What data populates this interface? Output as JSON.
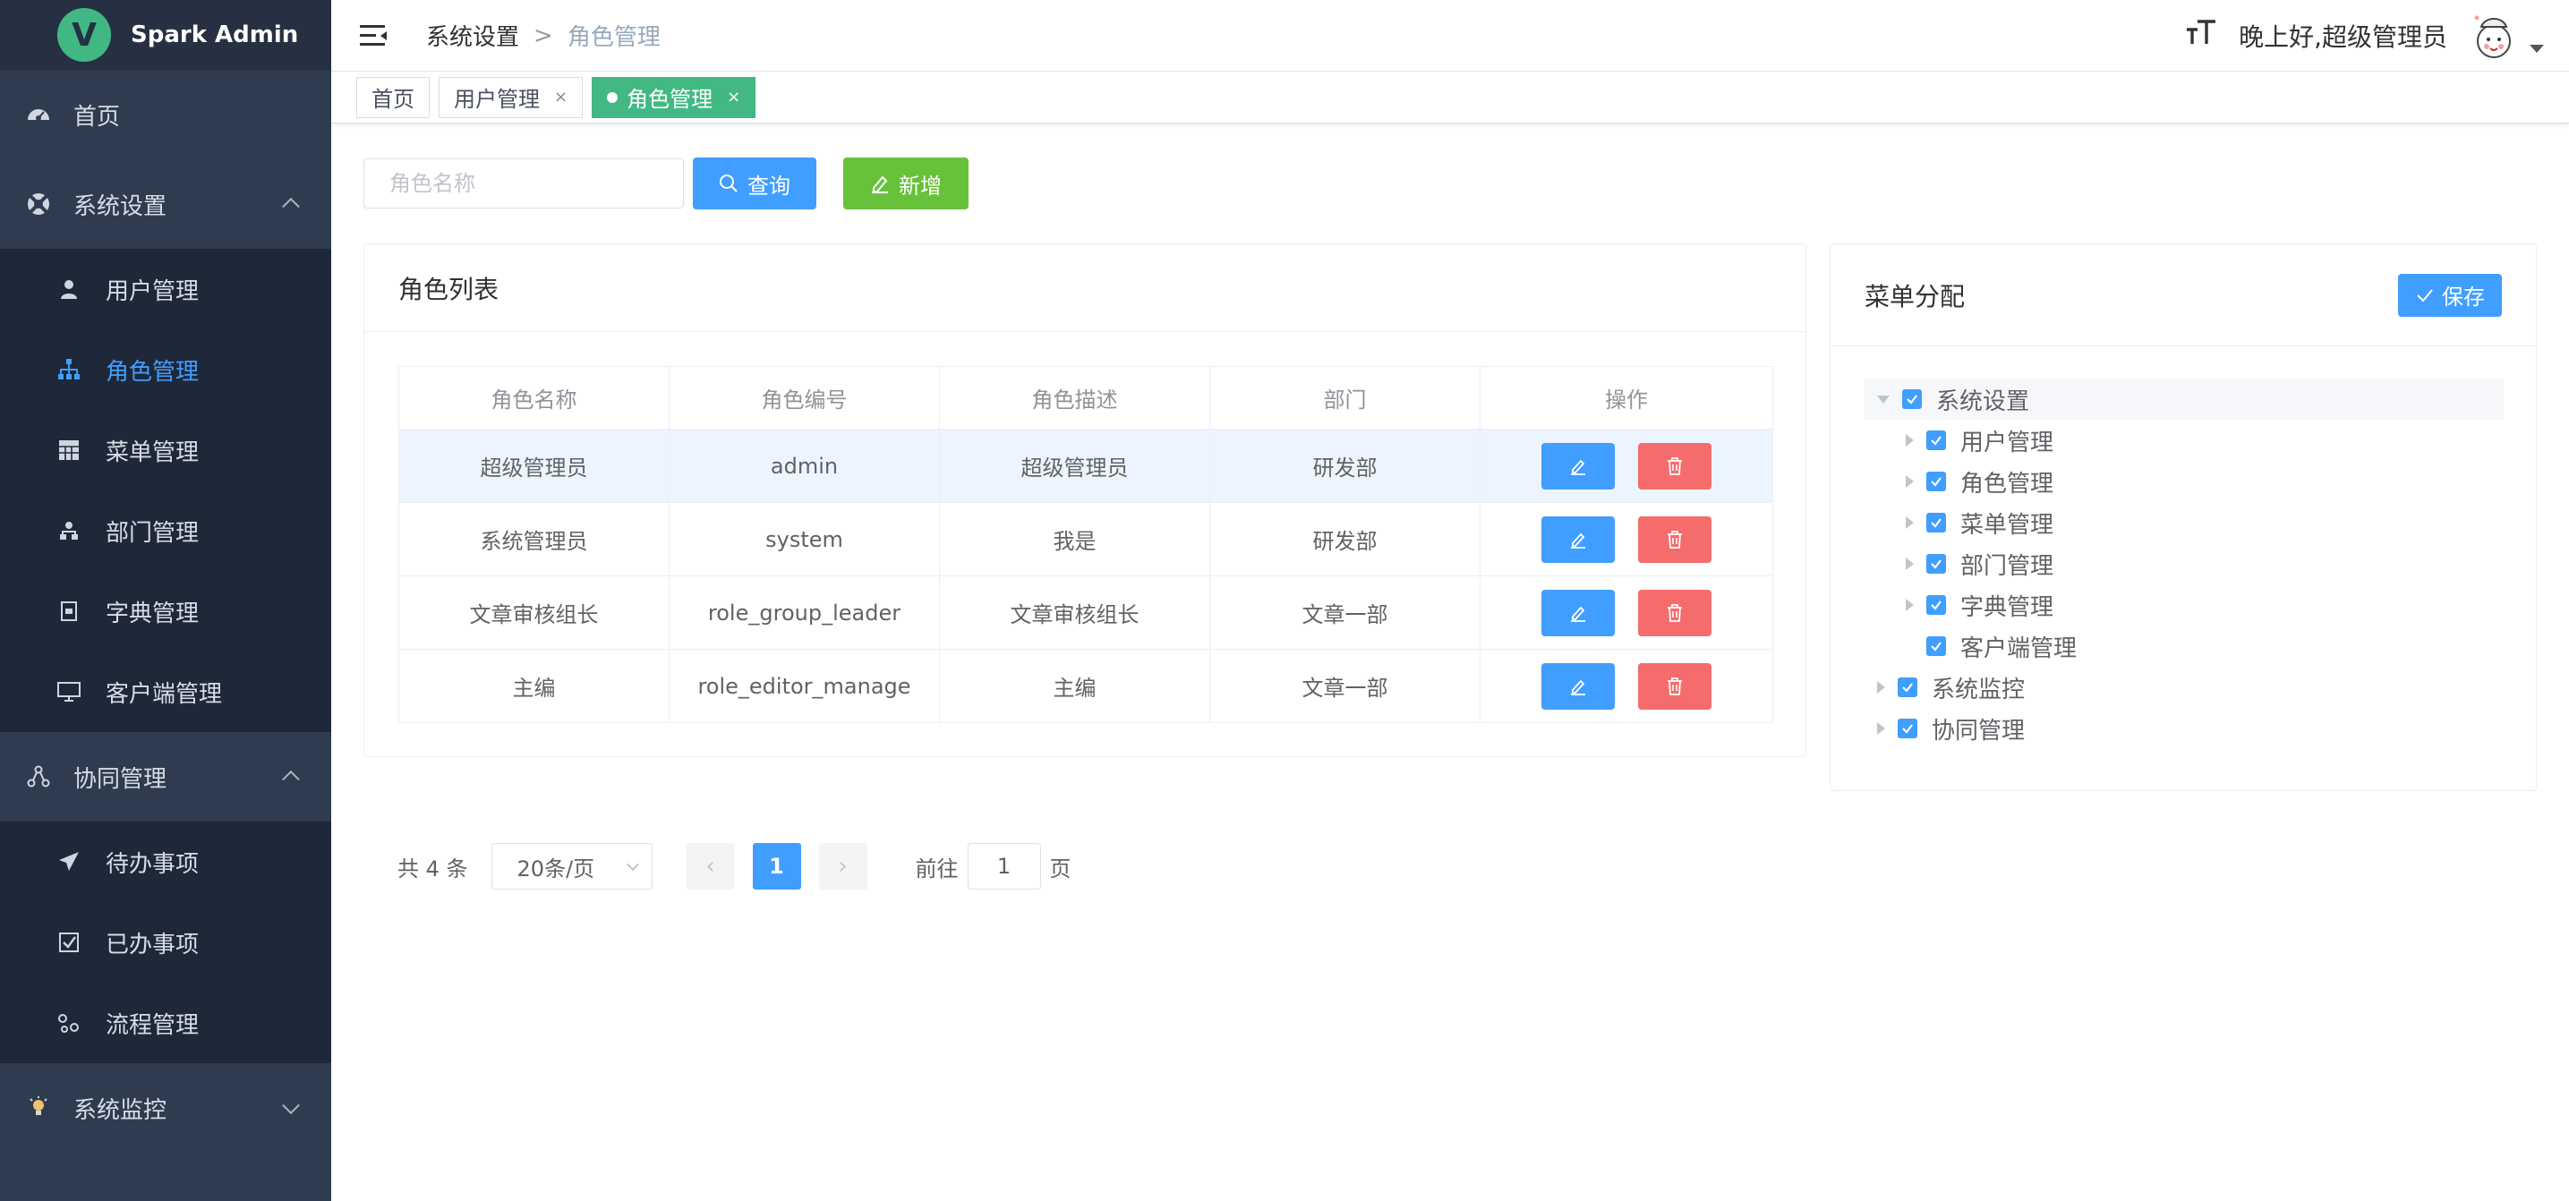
{
  "app": {
    "title": "Spark Admin",
    "logo_letter": "V"
  },
  "sidebar": {
    "home": "首页",
    "system_settings": "系统设置",
    "system_settings_children": [
      "用户管理",
      "角色管理",
      "菜单管理",
      "部门管理",
      "字典管理",
      "客户端管理"
    ],
    "collab": "协同管理",
    "collab_children": [
      "待办事项",
      "已办事项",
      "流程管理"
    ],
    "monitor": "系统监控",
    "active_item": "角色管理"
  },
  "header": {
    "breadcrumb": [
      "系统设置",
      "角色管理"
    ],
    "breadcrumb_sep": ">",
    "font_icon": "TT",
    "greeting": "晚上好,超级管理员"
  },
  "tags": [
    {
      "label": "首页",
      "closable": false,
      "active": false
    },
    {
      "label": "用户管理",
      "closable": true,
      "active": false
    },
    {
      "label": "角色管理",
      "closable": true,
      "active": true
    }
  ],
  "tag_close": "×",
  "toolbar": {
    "search_placeholder": "角色名称",
    "query_label": "查询",
    "add_label": "新增"
  },
  "role_list": {
    "title": "角色列表",
    "columns": [
      "角色名称",
      "角色编号",
      "角色描述",
      "部门",
      "操作"
    ],
    "rows": [
      [
        "超级管理员",
        "admin",
        "超级管理员",
        "研发部"
      ],
      [
        "系统管理员",
        "system",
        "我是",
        "研发部"
      ],
      [
        "文章审核组长",
        "role_group_leader",
        "文章审核组长",
        "文章一部"
      ],
      [
        "主编",
        "role_editor_manage",
        "主编",
        "文章一部"
      ]
    ]
  },
  "menu_assign": {
    "title": "菜单分配",
    "save_label": "保存",
    "tree": [
      {
        "label": "系统设置",
        "level": 0,
        "expand": "open",
        "checked": true
      },
      {
        "label": "用户管理",
        "level": 1,
        "expand": "closed",
        "checked": true
      },
      {
        "label": "角色管理",
        "level": 1,
        "expand": "closed",
        "checked": true
      },
      {
        "label": "菜单管理",
        "level": 1,
        "expand": "closed",
        "checked": true
      },
      {
        "label": "部门管理",
        "level": 1,
        "expand": "closed",
        "checked": true
      },
      {
        "label": "字典管理",
        "level": 1,
        "expand": "closed",
        "checked": true
      },
      {
        "label": "客户端管理",
        "level": 1,
        "expand": "none",
        "checked": true
      },
      {
        "label": "系统监控",
        "level": 0,
        "expand": "closed",
        "checked": true
      },
      {
        "label": "协同管理",
        "level": 0,
        "expand": "closed",
        "checked": true
      }
    ]
  },
  "pagination": {
    "total_text": "共 4 条",
    "page_size": "20条/页",
    "prev": "‹",
    "current_page": "1",
    "next": "›",
    "goto_prefix": "前往",
    "goto_value": "1",
    "goto_suffix": "页"
  },
  "colors": {
    "primary": "#409eff",
    "success": "#67c23a",
    "danger": "#f56c6c",
    "tag_active": "#42b983",
    "sidebar_bg": "#2f3b4e"
  }
}
